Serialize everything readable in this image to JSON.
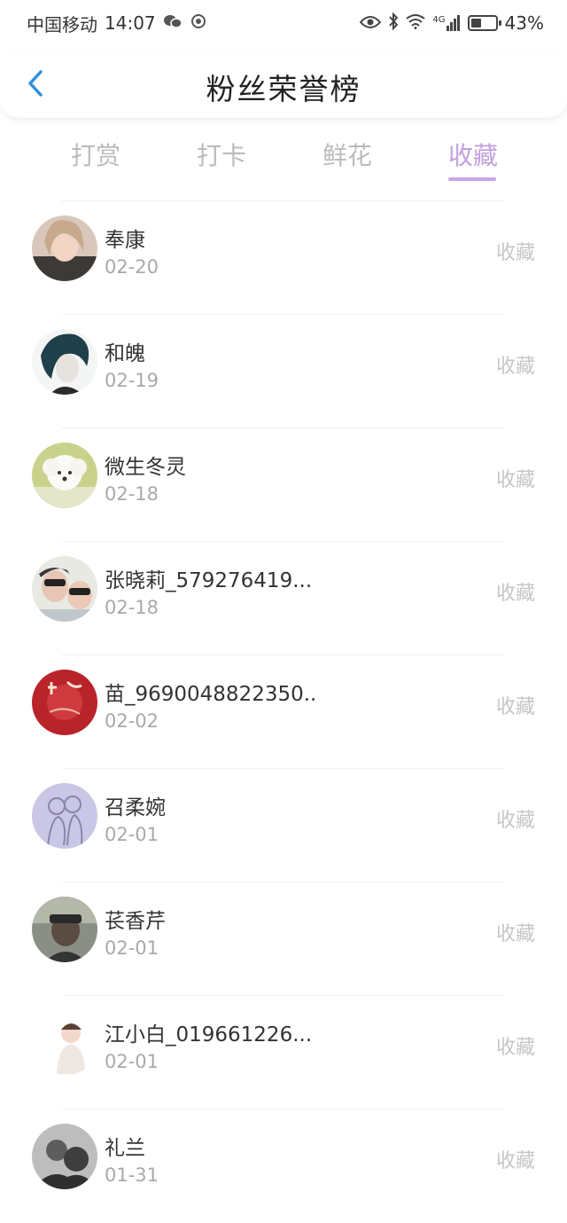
{
  "status_bar": {
    "carrier": "中国移动",
    "time": "14:07",
    "network": "4G",
    "battery": "43%",
    "battery_level": 0.43
  },
  "nav": {
    "title": "粉丝荣誉榜",
    "back_icon": "chevron-left-icon",
    "accent": "#2f8fe0"
  },
  "tabs": [
    {
      "label": "打赏",
      "active": false
    },
    {
      "label": "打卡",
      "active": false
    },
    {
      "label": "鲜花",
      "active": false
    },
    {
      "label": "收藏",
      "active": true
    }
  ],
  "colors": {
    "active_tab": "#c39fe0",
    "inactive_tab": "#bbbbbb",
    "action_text": "#c6c6c6"
  },
  "fans": [
    {
      "name": "奉康",
      "date": "02-20",
      "action": "收藏"
    },
    {
      "name": "和魄",
      "date": "02-19",
      "action": "收藏"
    },
    {
      "name": "微生冬灵",
      "date": "02-18",
      "action": "收藏"
    },
    {
      "name": "张晓莉_579276419...",
      "date": "02-18",
      "action": "收藏"
    },
    {
      "name": "苗_9690048822350...",
      "date": "02-02",
      "action": "收藏"
    },
    {
      "name": "召柔婉",
      "date": "02-01",
      "action": "收藏"
    },
    {
      "name": "苌香芹",
      "date": "02-01",
      "action": "收藏"
    },
    {
      "name": "江小白_019661226...",
      "date": "02-01",
      "action": "收藏"
    },
    {
      "name": "礼兰",
      "date": "01-31",
      "action": "收藏"
    }
  ]
}
